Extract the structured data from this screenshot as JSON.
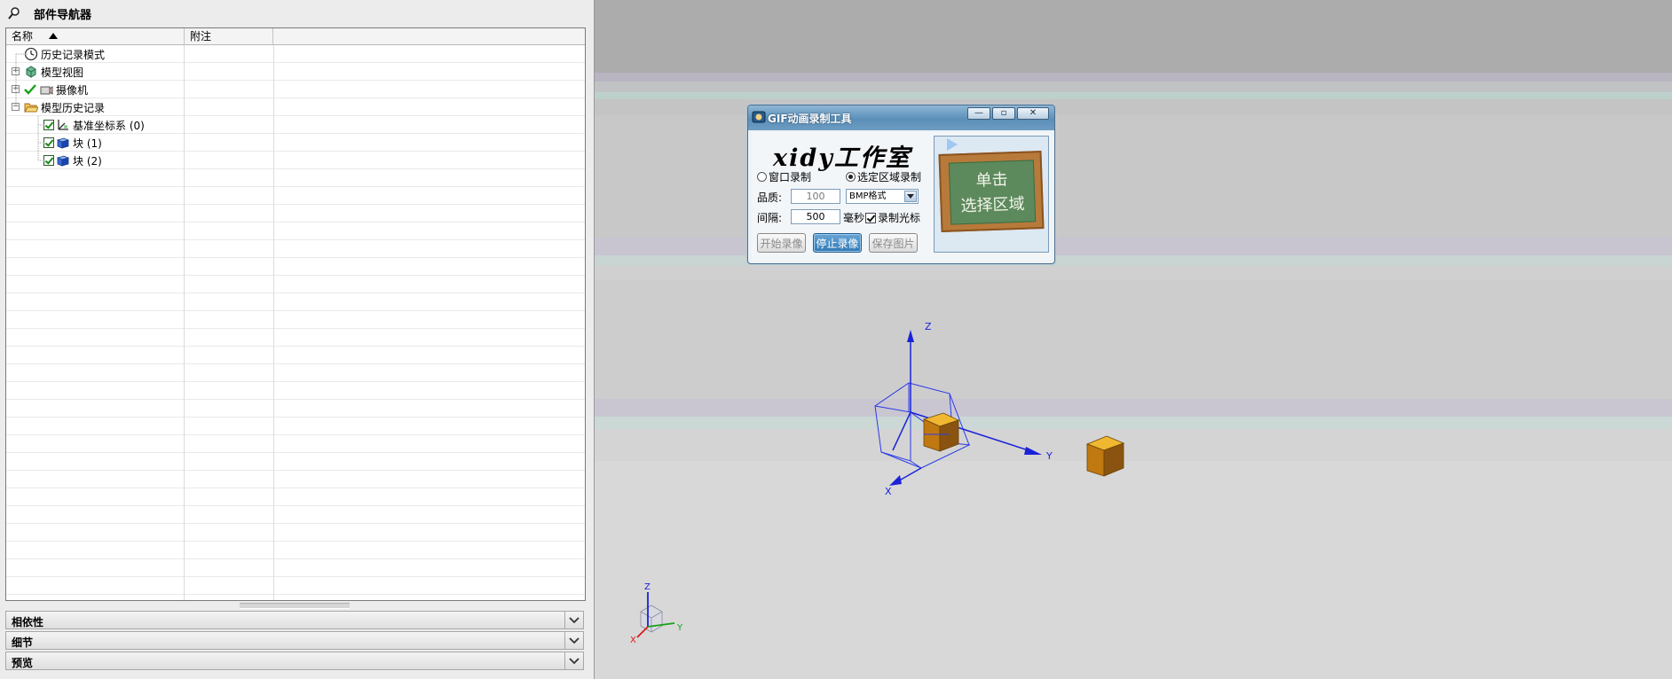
{
  "navigator": {
    "title": "部件导航器",
    "columns": {
      "name": "名称",
      "note": "附注"
    },
    "items": [
      {
        "label": "历史记录模式"
      },
      {
        "label": "模型视图"
      },
      {
        "label": "摄像机"
      },
      {
        "label": "模型历史记录"
      },
      {
        "label": "基准坐标系 (0)"
      },
      {
        "label": "块 (1)"
      },
      {
        "label": "块 (2)"
      }
    ],
    "sections": [
      {
        "label": "相依性"
      },
      {
        "label": "细节"
      },
      {
        "label": "预览"
      }
    ]
  },
  "gif_tool": {
    "title": "GIF动画录制工具",
    "studio_name": "xidy工作室",
    "mode_window": "窗口录制",
    "mode_region": "选定区域录制",
    "quality_label": "品质:",
    "quality_value": "100",
    "format_value": "BMP格式",
    "interval_label": "间隔:",
    "interval_value": "500",
    "interval_unit": "毫秒",
    "record_cursor": "录制光标",
    "start_button": "开始录像",
    "stop_button": "停止录像",
    "save_button": "保存图片",
    "board_line1": "单击",
    "board_line2": "选择区域"
  },
  "viewport": {
    "axis_x": "X",
    "axis_y": "Y",
    "axis_z": "Z"
  },
  "colors": {
    "cube_top": "#f0b830",
    "cube_front": "#c07810",
    "cube_side": "#8a5410",
    "axis_blue": "#1a22d8",
    "csys_blue": "#2a3ae8"
  }
}
